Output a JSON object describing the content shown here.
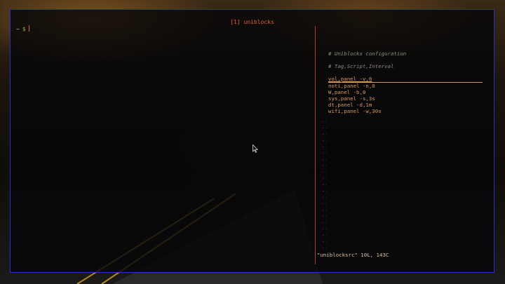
{
  "window": {
    "title": "[1] uniblocks"
  },
  "shell": {
    "tilde": "~",
    "dollar": "$"
  },
  "editor": {
    "comment_header": "# Uniblocks configuration",
    "comment_columns": "# Tag,Script,Interval",
    "lines": [
      "vol,panel -v,0",
      "noti,panel -n,0",
      "W,panel -b,0",
      "sys,panel -s,3s",
      "dt,panel -d,1m",
      "wifi,panel -w,30s"
    ],
    "status_line": "\"uniblocksrc\" 10L, 143C"
  },
  "colors": {
    "title": "#e0602e",
    "border": "#2a2ad6",
    "divider": "#b33a2a",
    "code": "#d89a5a",
    "prompt_dollar": "#8ea64b"
  },
  "icons": {
    "mouse": "mouse-pointer-icon"
  }
}
